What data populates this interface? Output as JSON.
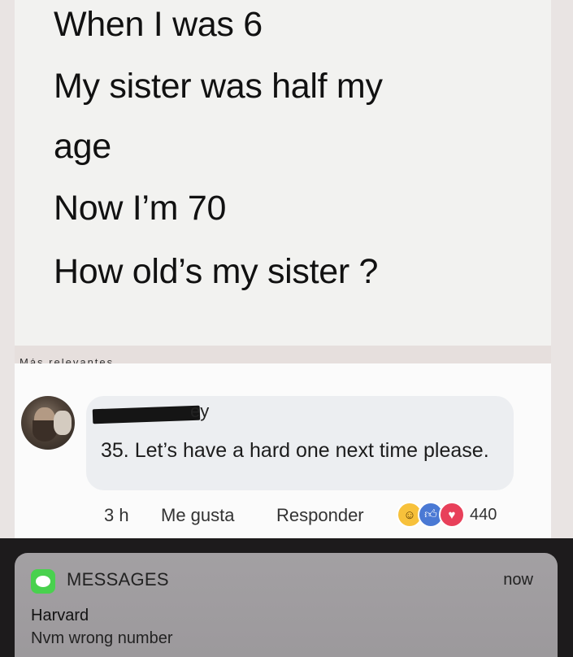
{
  "post": {
    "lines": [
      "When I was 6",
      "My sister was half my",
      "age",
      "Now I’m 70",
      "How old’s my sister ?"
    ],
    "cut_off_text": "Más relevantes"
  },
  "comment": {
    "name_partial": "ey",
    "text": "35. Let’s have a hard one next time please.",
    "time": "3 h",
    "like_label": "Me gusta",
    "reply_label": "Responder",
    "reactions": {
      "icons": [
        "haha-icon",
        "like-icon",
        "love-icon"
      ],
      "count": "440"
    }
  },
  "notification": {
    "app_name": "MESSAGES",
    "time": "now",
    "sender": "Harvard",
    "message": "Nvm wrong number",
    "accent_color": "#49d14e"
  }
}
